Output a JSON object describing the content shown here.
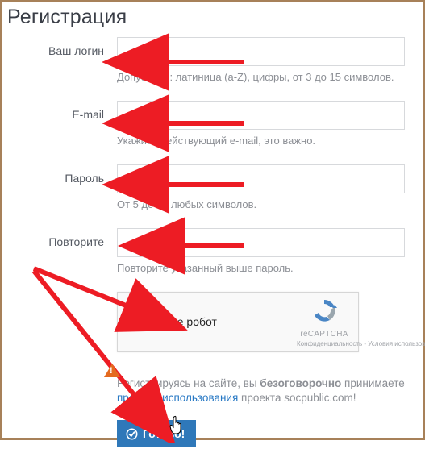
{
  "heading": "Регистрация",
  "fields": {
    "login": {
      "label": "Ваш логин",
      "hint": "Допустимо: латиница (a-Z), цифры, от 3 до 15 символов."
    },
    "email": {
      "label": "E-mail",
      "hint": "Укажите действующий e-mail, это важно."
    },
    "password": {
      "label": "Пароль",
      "hint": "От 5 до 25 любых символов."
    },
    "password2": {
      "label": "Повторите",
      "hint": "Повторите указанный выше пароль."
    }
  },
  "recaptcha": {
    "label": "Я не робот",
    "brand": "reCAPTCHA",
    "links": "Конфиденциальность - Условия использования"
  },
  "terms": {
    "prefix": "Регистрируясь на сайте, вы ",
    "bold": "безоговорочно",
    "mid": " принимаете ",
    "link": "правила использования",
    "suffix": " проекта socpublic.com!"
  },
  "submit": "Готово!"
}
